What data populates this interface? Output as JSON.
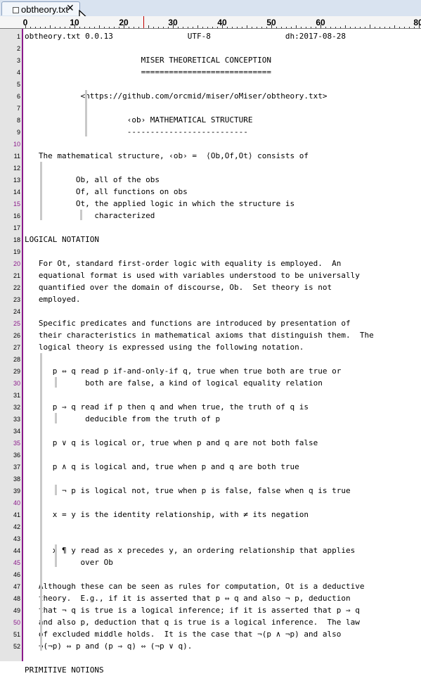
{
  "tab": {
    "title": "obtheory.txt",
    "close": "✕"
  },
  "ruler": {
    "labels": [
      "0",
      "10",
      "20",
      "30",
      "40",
      "50",
      "60",
      "80"
    ]
  },
  "lines": [
    {
      "n": "1",
      "mod": false,
      "text": "obtheory.txt 0.0.13                UTF-8                dh:2017-08-28"
    },
    {
      "n": "2",
      "mod": false,
      "text": ""
    },
    {
      "n": "3",
      "mod": false,
      "text": "                         MISER THEORETICAL CONCEPTION"
    },
    {
      "n": "4",
      "mod": false,
      "text": "                         ============================"
    },
    {
      "n": "5",
      "mod": false,
      "text": ""
    },
    {
      "n": "6",
      "mod": false,
      "text": "            <https://github.com/orcmid/miser/oMiser/obtheory.txt>"
    },
    {
      "n": "7",
      "mod": false,
      "text": ""
    },
    {
      "n": "8",
      "mod": false,
      "text": "                      ‹ob› MATHEMATICAL STRUCTURE"
    },
    {
      "n": "9",
      "mod": false,
      "text": "                      --------------------------"
    },
    {
      "n": "10",
      "mod": true,
      "text": ""
    },
    {
      "n": "11",
      "mod": false,
      "text": "   The mathematical structure, ‹ob› =  ⟨Ob,Of,Ot⟩ consists of"
    },
    {
      "n": "12",
      "mod": false,
      "text": ""
    },
    {
      "n": "13",
      "mod": false,
      "text": "           Ob, all of the obs"
    },
    {
      "n": "14",
      "mod": false,
      "text": "           Of, all functions on obs"
    },
    {
      "n": "15",
      "mod": true,
      "text": "           Ot, the applied logic in which the structure is"
    },
    {
      "n": "16",
      "mod": false,
      "text": "               characterized"
    },
    {
      "n": "17",
      "mod": false,
      "text": ""
    },
    {
      "n": "18",
      "mod": false,
      "text": "LOGICAL NOTATION"
    },
    {
      "n": "19",
      "mod": false,
      "text": ""
    },
    {
      "n": "20",
      "mod": true,
      "text": "   For Ot, standard first-order logic with equality is employed.  An"
    },
    {
      "n": "21",
      "mod": false,
      "text": "   equational format is used with variables understood to be universally"
    },
    {
      "n": "22",
      "mod": false,
      "text": "   quantified over the domain of discourse, Ob.  Set theory is not"
    },
    {
      "n": "23",
      "mod": false,
      "text": "   employed."
    },
    {
      "n": "24",
      "mod": false,
      "text": ""
    },
    {
      "n": "25",
      "mod": true,
      "text": "   Specific predicates and functions are introduced by presentation of"
    },
    {
      "n": "26",
      "mod": false,
      "text": "   their characteristics in mathematical axioms that distinguish them.  The"
    },
    {
      "n": "27",
      "mod": false,
      "text": "   logical theory is expressed using the following notation."
    },
    {
      "n": "28",
      "mod": false,
      "text": ""
    },
    {
      "n": "29",
      "mod": false,
      "text": "      p ⇔ q read p if-and-only-if q, true when true both are true or"
    },
    {
      "n": "30",
      "mod": true,
      "text": "             both are false, a kind of logical equality relation"
    },
    {
      "n": "31",
      "mod": false,
      "text": ""
    },
    {
      "n": "32",
      "mod": false,
      "text": "      p ⇒ q read if p then q and when true, the truth of q is"
    },
    {
      "n": "33",
      "mod": false,
      "text": "             deducible from the truth of p"
    },
    {
      "n": "34",
      "mod": false,
      "text": ""
    },
    {
      "n": "35",
      "mod": true,
      "text": "      p ∨ q is logical or, true when p and q are not both false"
    },
    {
      "n": "36",
      "mod": false,
      "text": ""
    },
    {
      "n": "37",
      "mod": false,
      "text": "      p ∧ q is logical and, true when p and q are both true"
    },
    {
      "n": "38",
      "mod": false,
      "text": ""
    },
    {
      "n": "39",
      "mod": false,
      "text": "        ¬ p is logical not, true when p is false, false when q is true"
    },
    {
      "n": "40",
      "mod": true,
      "text": ""
    },
    {
      "n": "41",
      "mod": false,
      "text": "      x = y is the identity relationship, with ≠ its negation"
    },
    {
      "n": "42",
      "mod": false,
      "text": ""
    },
    {
      "n": "43",
      "mod": false,
      "text": ""
    },
    {
      "n": "44",
      "mod": false,
      "text": "      x ¶ y read as x precedes y, an ordering relationship that applies"
    },
    {
      "n": "45",
      "mod": true,
      "text": "            over Ob"
    },
    {
      "n": "46",
      "mod": false,
      "text": ""
    },
    {
      "n": "47",
      "mod": false,
      "text": "   Although these can be seen as rules for computation, Ot is a deductive"
    },
    {
      "n": "48",
      "mod": false,
      "text": "   theory.  E.g., if it is asserted that p ⇔ q and also ¬ p, deduction"
    },
    {
      "n": "49",
      "mod": false,
      "text": "   that ¬ q is true is a logical inference; if it is asserted that p ⇒ q"
    },
    {
      "n": "50",
      "mod": true,
      "text": "   and also p, deduction that q is true is a logical inference.  The law"
    },
    {
      "n": "51",
      "mod": false,
      "text": "   of excluded middle holds.  It is the case that ¬(p ∧ ¬p) and also"
    },
    {
      "n": "52",
      "mod": false,
      "text": "   ¬(¬p) ⇔ p and (p ⇒ q) ⇔ (¬p ∨ q)."
    },
    {
      "n": "",
      "mod": false,
      "text": ""
    },
    {
      "n": "",
      "mod": false,
      "text": "PRIMITIVE NOTIONS"
    }
  ],
  "colors": {
    "modified_line_number": "#8b1a8b",
    "gutter": "#e4e4e4",
    "tab_bar": "#d9e3f0",
    "edge_marker": "#c00000"
  }
}
